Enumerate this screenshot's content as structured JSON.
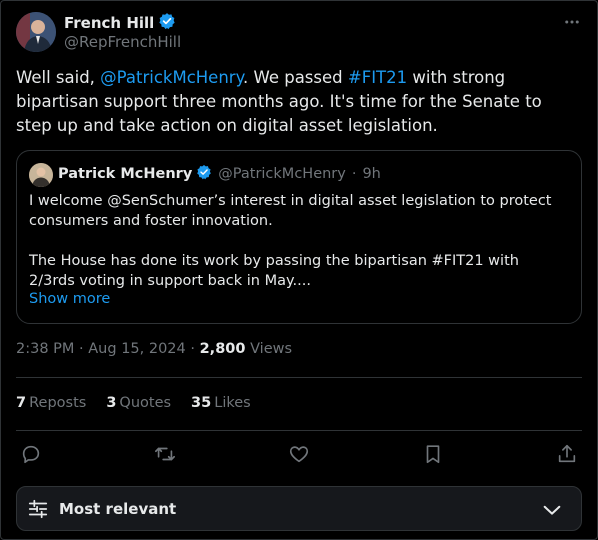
{
  "author": {
    "name": "French Hill",
    "handle": "@RepFrenchHill",
    "verified": true
  },
  "tweet": {
    "text_1": "Well said, ",
    "mention": "@PatrickMcHenry",
    "text_2": ". We passed ",
    "hashtag": "#FIT21",
    "text_3": " with strong bipartisan support three months ago. It's time for the Senate to step up and take action on digital asset legislation."
  },
  "quoted": {
    "name": "Patrick McHenry",
    "handle": "@PatrickMcHenry",
    "separator": "·",
    "time": "9h",
    "paragraph_1": "I welcome @SenSchumer’s interest in digital asset legislation to protect consumers and foster innovation.",
    "paragraph_2": "The House has done its work by passing the bipartisan #FIT21 with 2/3rds voting in support back in May....",
    "show_more": "Show more"
  },
  "meta": {
    "time": "2:38 PM",
    "dot1": " · ",
    "date": "Aug 15, 2024",
    "dot2": " · ",
    "views_count": "2,800",
    "views_label": "Views"
  },
  "stats": {
    "reposts_count": "7",
    "reposts_label": "Reposts",
    "quotes_count": "3",
    "quotes_label": "Quotes",
    "likes_count": "35",
    "likes_label": "Likes"
  },
  "sort": {
    "label": "Most relevant"
  },
  "colors": {
    "accent": "#1d9bf0",
    "background": "#000000",
    "muted": "#71767b",
    "border": "#2f3336"
  },
  "icons": [
    "verified-badge-icon",
    "more-icon",
    "reply-icon",
    "repost-icon",
    "like-icon",
    "bookmark-icon",
    "share-icon",
    "filter-sliders-icon",
    "chevron-down-icon"
  ]
}
